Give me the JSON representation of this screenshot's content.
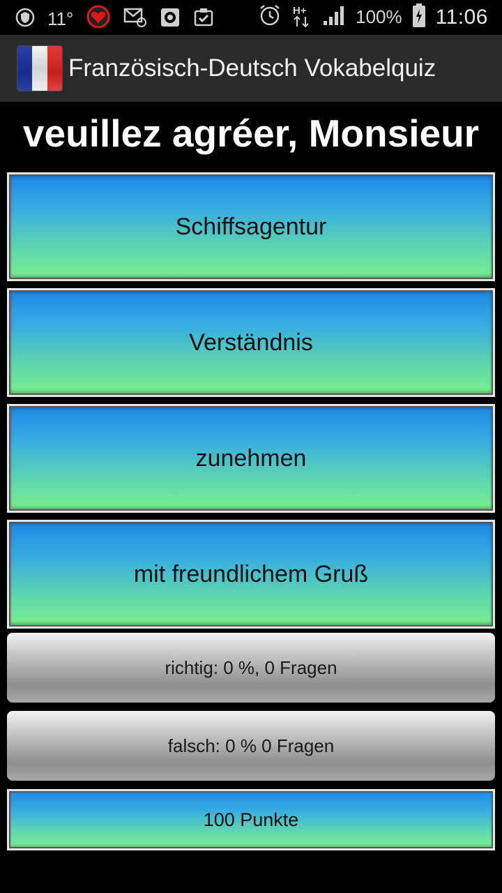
{
  "status_bar": {
    "temperature": "11°",
    "battery": "100%",
    "time": "11:06",
    "network_type": "H+",
    "icons": [
      "shield-icon",
      "heart-message-icon",
      "email-at-icon",
      "record-icon",
      "clipboard-check-icon",
      "alarm-icon",
      "network-arrows-icon",
      "signal-icon",
      "battery-charging-icon"
    ]
  },
  "app_bar": {
    "title": "Französisch-Deutsch Vokabelquiz",
    "logo": "france-flag-icon"
  },
  "quiz": {
    "question": "veuillez agréer, Monsieur",
    "answers": [
      "Schiffsagentur",
      "Verständnis",
      "zunehmen",
      "mit freundlichem Gruß"
    ]
  },
  "stats": {
    "correct": "richtig: 0 %, 0 Fragen",
    "wrong": "falsch: 0 % 0 Fragen",
    "points": "100 Punkte"
  },
  "colors": {
    "button_gradient_top": "#1e88e8",
    "button_gradient_bottom": "#7cf08c",
    "background": "#000000",
    "app_bar": "#2a2a2a"
  }
}
